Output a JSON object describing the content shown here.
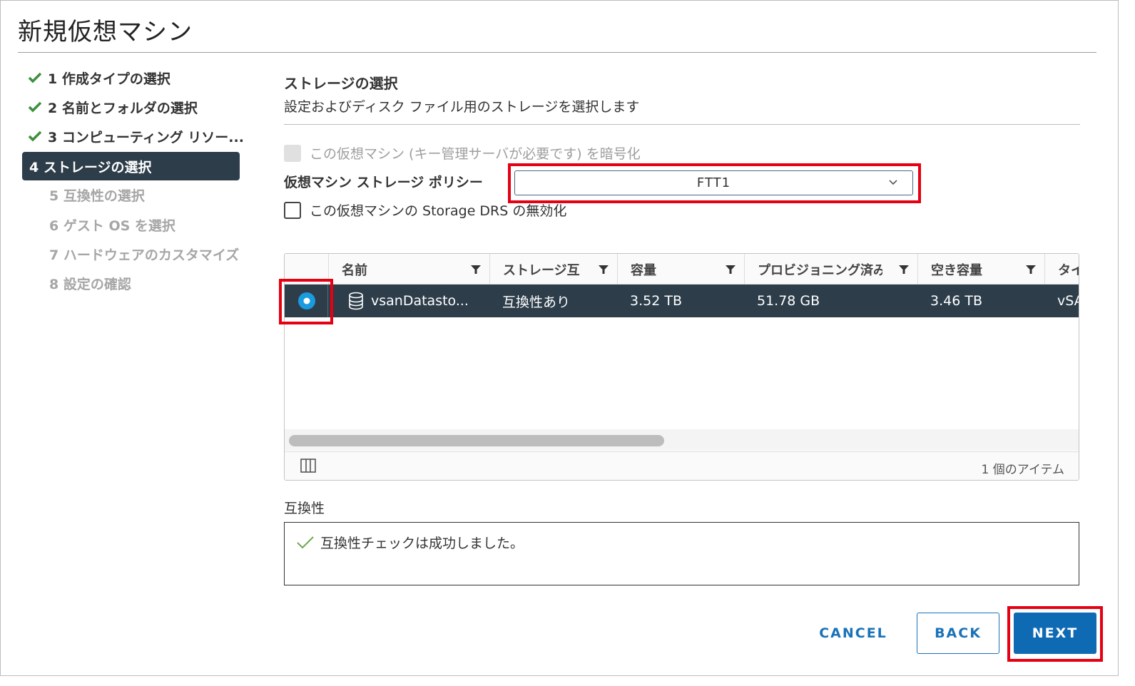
{
  "dialog": {
    "title": "新規仮想マシン"
  },
  "steps": [
    {
      "label": "1 作成タイプの選択",
      "status": "done"
    },
    {
      "label": "2 名前とフォルダの選択",
      "status": "done"
    },
    {
      "label": "3 コンピューティング リソー...",
      "status": "done"
    },
    {
      "label": "4 ストレージの選択",
      "status": "active"
    },
    {
      "label": "5 互換性の選択",
      "status": "pending"
    },
    {
      "label": "6 ゲスト OS を選択",
      "status": "pending"
    },
    {
      "label": "7 ハードウェアのカスタマイズ",
      "status": "pending"
    },
    {
      "label": "8 設定の確認",
      "status": "pending"
    }
  ],
  "storage": {
    "title": "ストレージの選択",
    "description": "設定およびディスク ファイル用のストレージを選択します",
    "encrypt_label": "この仮想マシン (キー管理サーバが必要です) を暗号化",
    "policy_label": "仮想マシン ストレージ ポリシー",
    "policy_value": "FTT1",
    "drs_label": "この仮想マシンの Storage DRS の無効化"
  },
  "grid": {
    "columns": [
      "名前",
      "ストレージ互",
      "容量",
      "プロビジョニング済み",
      "空き容量",
      "タイ"
    ],
    "rows": [
      {
        "name": "vsanDatasto...",
        "compat": "互換性あり",
        "capacity": "3.52 TB",
        "provisioned": "51.78 GB",
        "free": "3.46 TB",
        "type": "vSA"
      }
    ],
    "item_count": "1 個のアイテム"
  },
  "compatibility": {
    "label": "互換性",
    "message": "互換性チェックは成功しました。"
  },
  "buttons": {
    "cancel": "CANCEL",
    "back": "BACK",
    "next": "NEXT"
  },
  "colors": {
    "accent": "#0f6ab4",
    "highlight": "#e60012",
    "selected_row": "#2d3d4a",
    "check": "#3c8f3c"
  }
}
